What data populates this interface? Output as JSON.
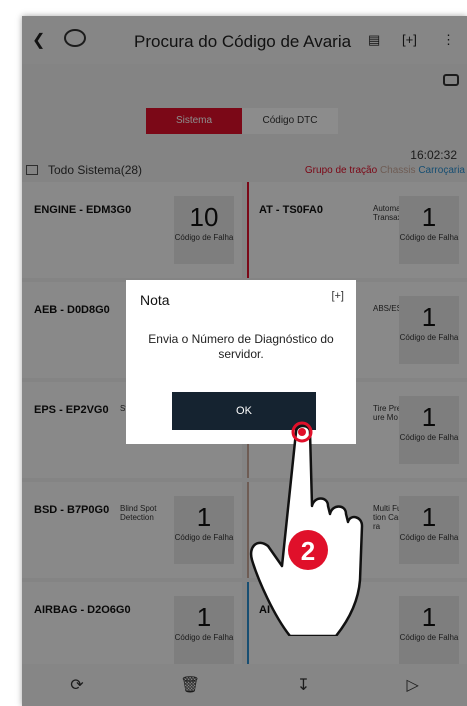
{
  "header": {
    "title": "Procura do Código de Avaria",
    "back_icon": "chevron-left-icon"
  },
  "toggle": {
    "sistema": "Sistema",
    "dtc": "Código DTC"
  },
  "time": "16:02:32",
  "system": {
    "label": "Todo Sistema(28)"
  },
  "categories": [
    {
      "label": "Grupo de tração",
      "color": "#e0102a"
    },
    {
      "label": "Chassis",
      "color": "#c9a89a"
    },
    {
      "label": "Carroçaria",
      "color": "#2a8fd0"
    }
  ],
  "cells": [
    {
      "name": "ENGINE - EDM3G0",
      "desc": "",
      "count": "10",
      "count_label": "Código de Falha",
      "accent": ""
    },
    {
      "name": "AT - TS0FA0",
      "desc": "Automatic Transaxle",
      "count": "1",
      "count_label": "Código de Falha",
      "accent": "#e0102a"
    },
    {
      "name": "AEB - D0D8G0",
      "desc": "",
      "count": "",
      "count_label": "",
      "accent": ""
    },
    {
      "name": "",
      "desc": "ABS/ESC",
      "count": "1",
      "count_label": "Código de Falha",
      "accent": "#c9a89a"
    },
    {
      "name": "EPS - EP2VG0",
      "desc": "Steering",
      "count": "",
      "count_label": "",
      "accent": ""
    },
    {
      "name": "",
      "desc": "Tire Pressure Mo",
      "count": "1",
      "count_label": "Código de Falha",
      "accent": "#c9a89a"
    },
    {
      "name": "BSD - B7P0G0",
      "desc": "Blind Spot Detection",
      "count": "1",
      "count_label": "Código de Falha",
      "accent": ""
    },
    {
      "name": "",
      "desc": "Multi Function Camera",
      "count": "1",
      "count_label": "Código de Falha",
      "accent": "#c9a89a"
    },
    {
      "name": "AIRBAG - D2O6G0",
      "desc": "",
      "count": "1",
      "count_label": "Código de Falha",
      "accent": ""
    },
    {
      "name": "AI",
      "desc": "",
      "count": "1",
      "count_label": "Código de Falha",
      "accent": "#2a8fd0"
    }
  ],
  "dialog": {
    "title": "Nota",
    "message": "Envia o Número de Diagnóstico do servidor.",
    "ok": "OK"
  },
  "step_badge": "2"
}
